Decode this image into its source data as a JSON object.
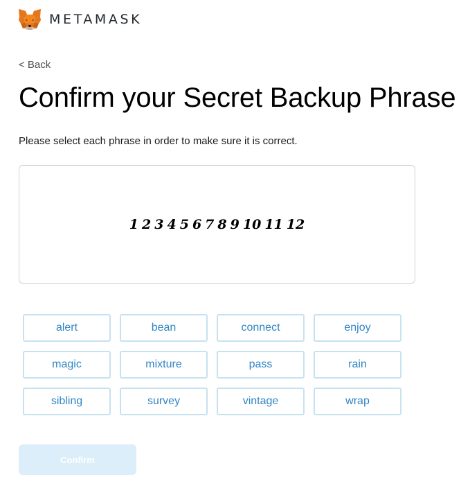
{
  "header": {
    "logo_icon": "metamask-fox-icon",
    "brand_name": "METAMASK"
  },
  "nav": {
    "back_label": "< Back"
  },
  "page": {
    "title": "Confirm your Secret Backup Phrase",
    "subtitle": "Please select each phrase in order to make sure it is correct."
  },
  "phrase_slots": [
    "1",
    "2",
    "3",
    "4",
    "5",
    "6",
    "7",
    "8",
    "9",
    "10",
    "11",
    "12"
  ],
  "word_options": [
    "alert",
    "bean",
    "connect",
    "enjoy",
    "magic",
    "mixture",
    "pass",
    "rain",
    "sibling",
    "survey",
    "vintage",
    "wrap"
  ],
  "actions": {
    "confirm_label": "Confirm",
    "confirm_enabled": false
  },
  "colors": {
    "word_text": "#3185c4",
    "word_border": "#c6e2f0",
    "confirm_disabled_bg": "#dbeefa"
  }
}
